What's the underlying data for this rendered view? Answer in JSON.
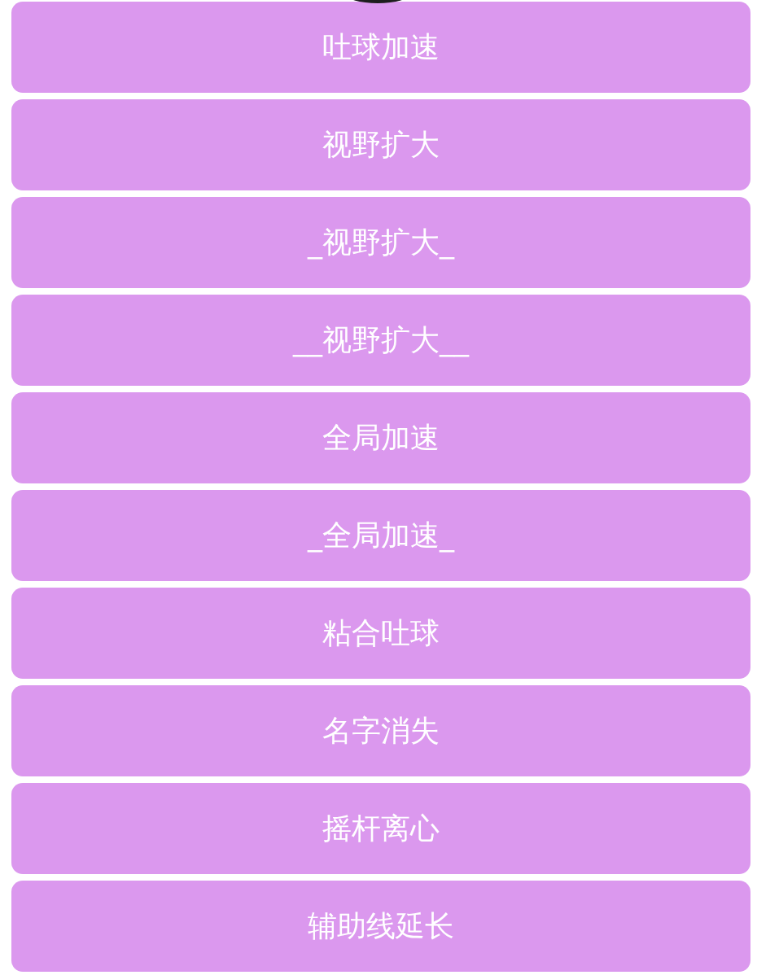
{
  "buttons": [
    {
      "label": "吐球加速"
    },
    {
      "label": "视野扩大"
    },
    {
      "label": "_视野扩大_"
    },
    {
      "label": "__视野扩大__"
    },
    {
      "label": "全局加速"
    },
    {
      "label": "_全局加速_"
    },
    {
      "label": "粘合吐球"
    },
    {
      "label": "名字消失"
    },
    {
      "label": "摇杆离心"
    },
    {
      "label": "辅助线延长"
    }
  ]
}
